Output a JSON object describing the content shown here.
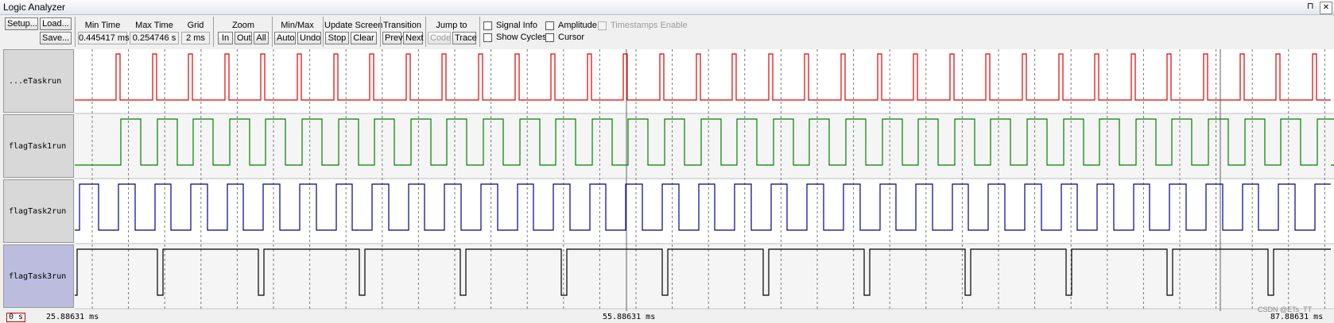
{
  "window": {
    "title": "Logic Analyzer",
    "pin_glyph": "⊓",
    "close_glyph": "✕"
  },
  "toolbar": {
    "setup": "Setup...",
    "load": "Load...",
    "save": "Save...",
    "min_time_label": "Min Time",
    "min_time_value": "0.445417 ms",
    "max_time_label": "Max Time",
    "max_time_value": "0.254746 s",
    "grid_label": "Grid",
    "grid_value": "2 ms",
    "zoom_label": "Zoom",
    "zoom_in": "In",
    "zoom_out": "Out",
    "zoom_all": "All",
    "minmax_label": "Min/Max",
    "minmax_auto": "Auto",
    "minmax_undo": "Undo",
    "update_label": "Update Screen",
    "update_stop": "Stop",
    "update_clear": "Clear",
    "transition_label": "Transition",
    "transition_prev": "Prev",
    "transition_next": "Next",
    "jump_label": "Jump to",
    "jump_code": "Code",
    "jump_trace": "Trace",
    "signal_info": "Signal Info",
    "show_cycles": "Show Cycles",
    "amplitude": "Amplitude",
    "cursor": "Cursor",
    "timestamps": "Timestamps Enable"
  },
  "signals": [
    {
      "name": "...eTaskrun",
      "high": "1",
      "low": "0",
      "color": "#e00000",
      "kind": "pulse",
      "selected": false
    },
    {
      "name": "flagTask1run",
      "high": "1",
      "low": "0",
      "color": "#008000",
      "kind": "square",
      "selected": false
    },
    {
      "name": "flagTask2run",
      "high": "1",
      "low": "0",
      "color": "#00008b",
      "kind": "square",
      "selected": false
    },
    {
      "name": "flagTask3run",
      "high": "1",
      "low": "0",
      "color": "#000000",
      "kind": "sparse",
      "selected": true
    }
  ],
  "status": {
    "zero": "0 s",
    "t_left": "25.88631 ms",
    "t_mid": "55.88631 ms",
    "t_right": "87.88631 ms"
  },
  "watermark": "CSDN @ETs_TT"
}
